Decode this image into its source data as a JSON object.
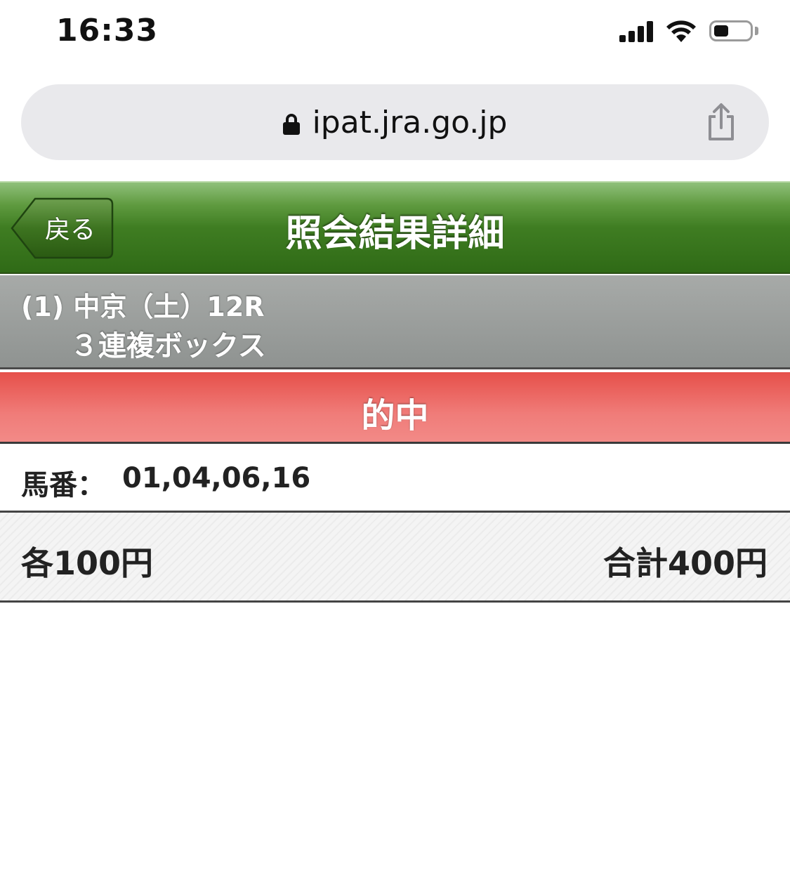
{
  "status_bar": {
    "time": "16:33",
    "icons": [
      "signal-icon",
      "wifi-icon",
      "battery-icon"
    ]
  },
  "browser": {
    "url": "ipat.jra.go.jp",
    "icons": [
      "lock-icon",
      "share-icon"
    ]
  },
  "header": {
    "back_label": "戻る",
    "title": "照会結果詳細",
    "colors": {
      "header_green": "#3f7d22",
      "result_red": "#e6504a",
      "race_gray": "#9a9d9b"
    }
  },
  "race": {
    "line1": "(1) 中京（土）12R",
    "line2": "３連複ボックス"
  },
  "result": {
    "status": "的中"
  },
  "bet": {
    "horse_label": "馬番：",
    "horse_numbers": "01,04,06,16",
    "each_amount": "各100円",
    "total_amount": "合計400円"
  }
}
